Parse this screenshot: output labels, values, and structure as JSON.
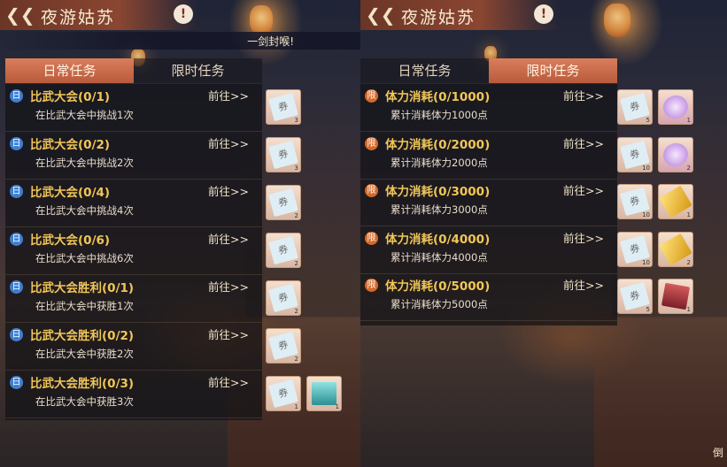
{
  "left_panel": {
    "title": "夜游姑苏",
    "info_label": "!",
    "subtitle": "一剑封喉!",
    "tabs": [
      {
        "label": "日常任务",
        "active": true
      },
      {
        "label": "限时任务",
        "active": false
      }
    ],
    "tasks": [
      {
        "badge": "日",
        "name": "比武大会(0/1)",
        "desc": "在比武大会中挑战1次",
        "goto": "前往>>",
        "rewards": [
          {
            "glyph": "券",
            "count": "3",
            "kind": "ticket"
          }
        ]
      },
      {
        "badge": "日",
        "name": "比武大会(0/2)",
        "desc": "在比武大会中挑战2次",
        "goto": "前往>>",
        "rewards": [
          {
            "glyph": "券",
            "count": "3",
            "kind": "ticket"
          }
        ]
      },
      {
        "badge": "日",
        "name": "比武大会(0/4)",
        "desc": "在比武大会中挑战4次",
        "goto": "前往>>",
        "rewards": [
          {
            "glyph": "券",
            "count": "2",
            "kind": "ticket"
          }
        ]
      },
      {
        "badge": "日",
        "name": "比武大会(0/6)",
        "desc": "在比武大会中挑战6次",
        "goto": "前往>>",
        "rewards": [
          {
            "glyph": "券",
            "count": "2",
            "kind": "ticket"
          }
        ]
      },
      {
        "badge": "日",
        "name": "比武大会胜利(0/1)",
        "desc": "在比武大会中获胜1次",
        "goto": "前往>>",
        "rewards": [
          {
            "glyph": "券",
            "count": "2",
            "kind": "ticket"
          }
        ]
      },
      {
        "badge": "日",
        "name": "比武大会胜利(0/2)",
        "desc": "在比武大会中获胜2次",
        "goto": "前往>>",
        "rewards": [
          {
            "glyph": "券",
            "count": "2",
            "kind": "ticket"
          }
        ]
      },
      {
        "badge": "日",
        "name": "比武大会胜利(0/3)",
        "desc": "在比武大会中获胜3次",
        "goto": "前往>>",
        "rewards": [
          {
            "glyph": "券",
            "count": "1",
            "kind": "ticket"
          },
          {
            "glyph": "",
            "count": "1",
            "kind": "book"
          }
        ]
      }
    ]
  },
  "right_panel": {
    "title": "夜游姑苏",
    "info_label": "!",
    "tabs": [
      {
        "label": "日常任务",
        "active": false
      },
      {
        "label": "限时任务",
        "active": true
      }
    ],
    "tasks": [
      {
        "badge": "限",
        "name": "体力消耗(0/1000)",
        "desc": "累计消耗体力1000点",
        "goto": "前往>>",
        "rewards": [
          {
            "glyph": "券",
            "count": "5",
            "kind": "ticket"
          },
          {
            "glyph": "",
            "count": "1",
            "kind": "gem"
          }
        ]
      },
      {
        "badge": "限",
        "name": "体力消耗(0/2000)",
        "desc": "累计消耗体力2000点",
        "goto": "前往>>",
        "rewards": [
          {
            "glyph": "券",
            "count": "10",
            "kind": "ticket"
          },
          {
            "glyph": "",
            "count": "2",
            "kind": "gem"
          }
        ]
      },
      {
        "badge": "限",
        "name": "体力消耗(0/3000)",
        "desc": "累计消耗体力3000点",
        "goto": "前往>>",
        "rewards": [
          {
            "glyph": "券",
            "count": "10",
            "kind": "ticket"
          },
          {
            "glyph": "",
            "count": "1",
            "kind": "gold"
          }
        ]
      },
      {
        "badge": "限",
        "name": "体力消耗(0/4000)",
        "desc": "累计消耗体力4000点",
        "goto": "前往>>",
        "rewards": [
          {
            "glyph": "券",
            "count": "10",
            "kind": "ticket"
          },
          {
            "glyph": "",
            "count": "2",
            "kind": "gold"
          }
        ]
      },
      {
        "badge": "限",
        "name": "体力消耗(0/5000)",
        "desc": "累计消耗体力5000点",
        "goto": "前往>>",
        "rewards": [
          {
            "glyph": "券",
            "count": "5",
            "kind": "ticket"
          },
          {
            "glyph": "",
            "count": "1",
            "kind": "fan"
          }
        ]
      }
    ],
    "corner_text": "倒"
  }
}
